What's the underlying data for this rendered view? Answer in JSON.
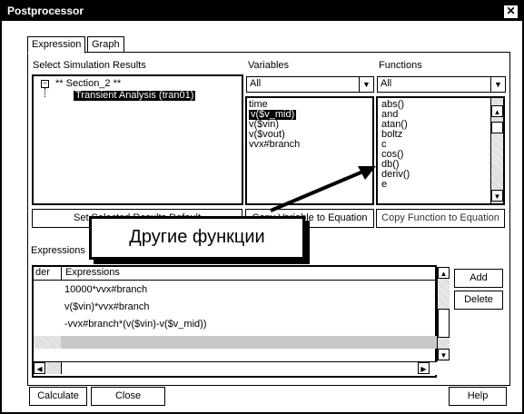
{
  "window": {
    "title": "Postprocessor"
  },
  "tabs": [
    {
      "label": "Expression"
    },
    {
      "label": "Graph"
    }
  ],
  "results": {
    "label": "Select Simulation Results",
    "tree_root": "** Section_2 **",
    "tree_child": "Transient Analysis (tran01)",
    "button": "Set Selected Results Default"
  },
  "variables": {
    "label": "Variables",
    "filter": "All",
    "items": [
      "time",
      "v($v_mid)",
      "v($vin)",
      "v($vout)",
      "vvx#branch"
    ],
    "button": "Copy Variable to Equation"
  },
  "functions": {
    "label": "Functions",
    "filter": "All",
    "items": [
      "abs()",
      "and",
      "atan()",
      "boltz",
      "c",
      "cos()",
      "db()",
      "deriv()",
      "e"
    ],
    "button": "Copy Function to Equation"
  },
  "expressions": {
    "label": "Expressions",
    "col_order": "der",
    "col_expr": "Expressions",
    "rows": [
      "10000*vvx#branch",
      "v($vin)*vvx#branch",
      "-vvx#branch*(v($vin)-v($v_mid))",
      ""
    ],
    "add": "Add",
    "delete": "Delete"
  },
  "footer": {
    "calculate": "Calculate",
    "close": "Close",
    "help": "Help"
  },
  "callout": {
    "text": "Другие функции"
  }
}
